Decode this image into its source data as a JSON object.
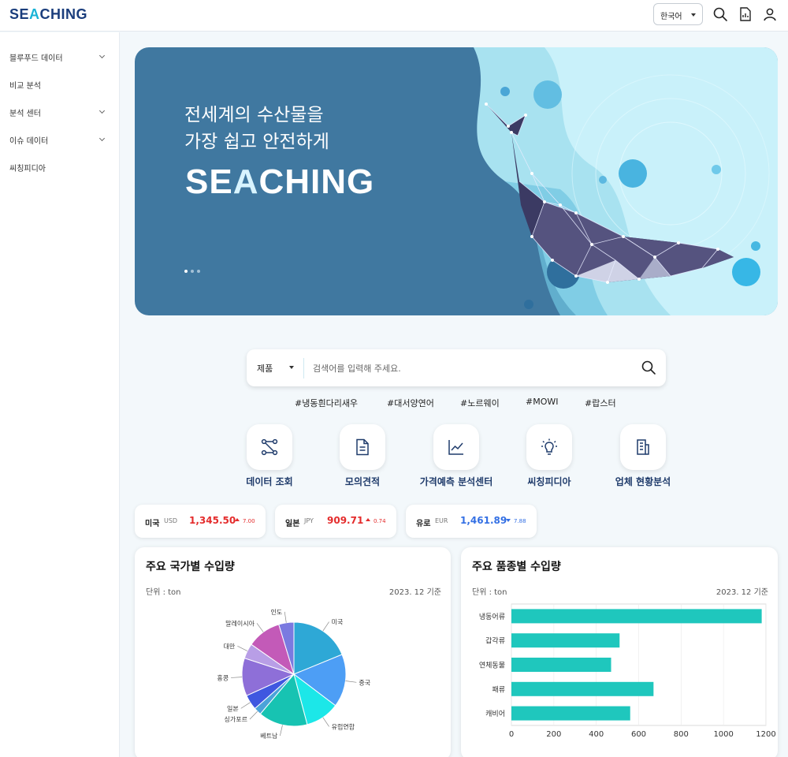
{
  "header": {
    "logo_text_1": "SE",
    "logo_text_2": "A",
    "logo_text_3": "CHING",
    "language": "한국어"
  },
  "sidebar": {
    "items": [
      {
        "label": "블루푸드 데이터",
        "expandable": true
      },
      {
        "label": "비교 분석",
        "expandable": false
      },
      {
        "label": "분석 센터",
        "expandable": true
      },
      {
        "label": "이슈 데이터",
        "expandable": true
      },
      {
        "label": "씨칭피디아",
        "expandable": false
      }
    ]
  },
  "banner": {
    "line1": "전세계의 수산물을",
    "line2": "가장 쉽고 안전하게",
    "logo_1": "SE",
    "logo_2": "A",
    "logo_3": "CHING",
    "slide_count": 3,
    "active_slide": 1
  },
  "search": {
    "category": "제품",
    "placeholder": "검색어를 입력해 주세요."
  },
  "tags": [
    "#냉동흰다리새우",
    "#대서양연어",
    "#노르웨이",
    "#MOWI",
    "#랍스터"
  ],
  "quick_menu": [
    {
      "label": "데이터 조회",
      "icon": "data-flow-icon"
    },
    {
      "label": "모의견적",
      "icon": "document-icon"
    },
    {
      "label": "가격예측 분석센터",
      "icon": "line-chart-icon"
    },
    {
      "label": "씨칭피디아",
      "icon": "lightbulb-icon"
    },
    {
      "label": "업체 현황분석",
      "icon": "building-icon"
    }
  ],
  "exchange_rates": [
    {
      "country": "미국",
      "currency": "USD",
      "value": "1,345.50",
      "change": "7.00",
      "direction": "up"
    },
    {
      "country": "일본",
      "currency": "JPY",
      "value": "909.71",
      "change": "0.74",
      "direction": "up"
    },
    {
      "country": "유로",
      "currency": "EUR",
      "value": "1,461.89",
      "change": "7.88",
      "direction": "down"
    }
  ],
  "panels": {
    "country": {
      "title": "주요 국가별 수입량",
      "unit": "단위 : ton",
      "date": "2023. 12 기준"
    },
    "item": {
      "title": "주요 품종별 수입량",
      "unit": "단위 : ton",
      "date": "2023. 12 기준"
    }
  },
  "chart_data": [
    {
      "type": "pie",
      "labels": [
        "미국",
        "중국",
        "유럽연합",
        "베트남",
        "싱가포르",
        "일본",
        "홍콩",
        "대만",
        "말레이시아",
        "인도"
      ],
      "values": [
        16,
        14,
        9,
        13,
        2,
        4,
        10,
        4,
        9,
        4
      ],
      "colors": [
        "#2ea8d6",
        "#4d9ef5",
        "#1ce7e8",
        "#17c3b2",
        "#4ba3d9",
        "#3f57e0",
        "#8e6fd8",
        "#b89ee6",
        "#c35ab8",
        "#7a7ae0"
      ]
    },
    {
      "type": "bar",
      "orientation": "horizontal",
      "categories": [
        "냉동어류",
        "갑각류",
        "연체동물",
        "패류",
        "캐비어"
      ],
      "values": [
        1180,
        510,
        470,
        670,
        560
      ],
      "xlim": [
        0,
        1200
      ],
      "xticks": [
        0,
        200,
        400,
        600,
        800,
        1000,
        1200
      ],
      "color": "#1fc7bd"
    }
  ]
}
